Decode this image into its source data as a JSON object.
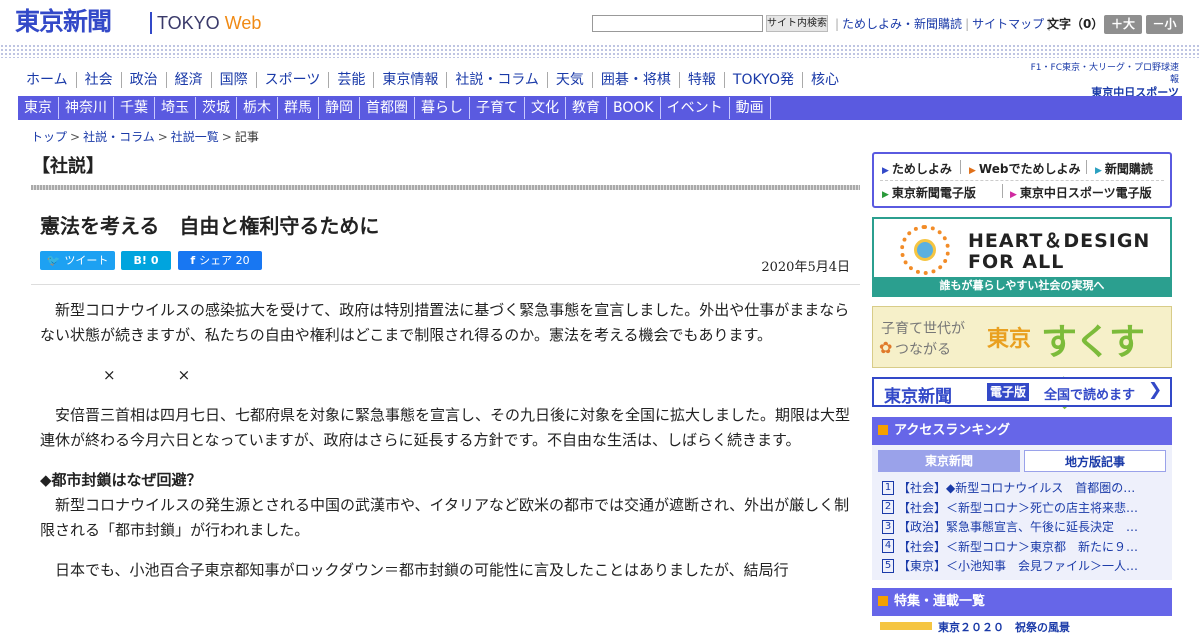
{
  "header": {
    "logo_ja": "東京新聞",
    "logo_en_a": "TOKYO",
    "logo_en_b": "Web",
    "search_button": "サイト内検索",
    "links": [
      "ためしよみ・新聞購読",
      "サイトマップ"
    ],
    "font_size_label": "文字（0）",
    "font_up": "＋大",
    "font_down": "－小"
  },
  "main_nav": [
    "ホーム",
    "社会",
    "政治",
    "経済",
    "国際",
    "スポーツ",
    "芸能",
    "東京情報",
    "社説・コラム",
    "天気",
    "囲碁・将棋",
    "特報",
    "TOKYO発",
    "核心"
  ],
  "chunichi": {
    "line1": "F1・FC東京・大リーグ・プロ野球速報",
    "line2": "東京中日スポーツ"
  },
  "sub_nav": [
    "東京",
    "神奈川",
    "千葉",
    "埼玉",
    "茨城",
    "栃木",
    "群馬",
    "静岡",
    "首都圏",
    "暮らし",
    "子育て",
    "文化",
    "教育",
    "BOOK",
    "イベント",
    "動画"
  ],
  "breadcrumb": [
    "トップ",
    "社説・コラム",
    "社説一覧",
    "記事"
  ],
  "article": {
    "section": "【社説】",
    "title": "憲法を考える　自由と権利守るために",
    "share": {
      "tweet": "ツイート",
      "hatena_icon": "B!",
      "hatena_count": "0",
      "fb_label": "シェア",
      "fb_count": "20"
    },
    "date": "2020年5月4日",
    "p1": "新型コロナウイルスの感染拡大を受けて、政府は特別措置法に基づく緊急事態を宣言しました。外出や仕事がままならない状態が続きますが、私たちの自由や権利はどこまで制限され得るのか。憲法を考える機会でもあります。",
    "cross1": "×",
    "cross2": "×",
    "p2": "安倍晋三首相は四月七日、七都府県を対象に緊急事態を宣言し、その九日後に対象を全国に拡大しました。期限は大型連休が終わる今月六日となっていますが、政府はさらに延長する方針です。不自由な生活は、しばらく続きます。",
    "h1": "◆都市封鎖はなぜ回避？",
    "p3": "新型コロナウイルスの発生源とされる中国の武漢市や、イタリアなど欧米の都市では交通が遮断され、外出が厳しく制限される「都市封鎖」が行われました。",
    "p4": "日本でも、小池百合子東京都知事がロックダウン＝都市封鎖の可能性に言及したことはありましたが、結局行"
  },
  "quick_links": [
    "ためしよみ",
    "Webでためしよみ",
    "新聞購読",
    "東京新聞電子版",
    "東京中日スポーツ電子版"
  ],
  "banners": {
    "heart_l1": "HEART＆DESIGN",
    "heart_l2": "FOR ALL",
    "heart_caption": "誰もが暮らしやすい社会の実現へ",
    "suku_small1": "子育て世代が",
    "suku_small2": "つながる",
    "suku_big1": "東京",
    "suku_big2": "すくすく",
    "denshi_a": "東京新聞",
    "denshi_b": "電子版",
    "denshi_c": "全国で読めます",
    "denshi_arrow": "❯"
  },
  "ranking": {
    "title": "アクセスランキング",
    "tab_active": "東京新聞",
    "tab_inactive": "地方版記事",
    "items": [
      {
        "num": "1",
        "text": "【社会】◆新型コロナウイルス　首都圏の…"
      },
      {
        "num": "2",
        "text": "【社会】＜新型コロナ＞死亡の店主将来悲…"
      },
      {
        "num": "3",
        "text": "【政治】緊急事態宣言、午後に延長決定　…"
      },
      {
        "num": "4",
        "text": "【社会】＜新型コロナ＞東京都　新たに９…"
      },
      {
        "num": "5",
        "text": "【東京】＜小池知事　会見ファイル＞一人…"
      }
    ]
  },
  "feature": {
    "title": "特集・連載一覧",
    "first_item": "東京２０２０　祝祭の風景"
  },
  "colors": {
    "brand": "#3349c8",
    "subnav": "#5a5ae0",
    "accent": "#f08a14"
  }
}
